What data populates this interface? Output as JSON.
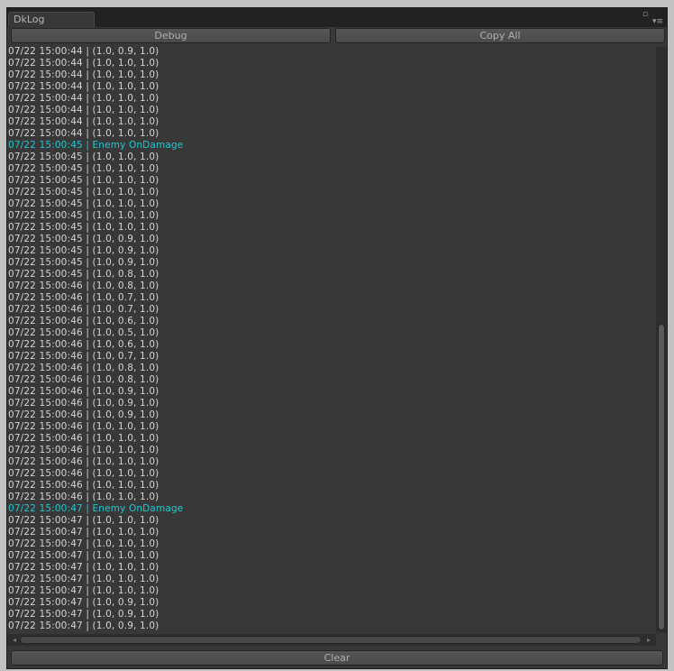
{
  "window": {
    "tab_title": "DkLog",
    "maximize_glyph": "▫",
    "menu_glyph": "▾≡"
  },
  "toolbar": {
    "debug_label": "Debug",
    "copy_all_label": "Copy All"
  },
  "scroll": {
    "left_arrow": "◂",
    "right_arrow": "▸",
    "vertical_position": 0.45
  },
  "log_lines": [
    {
      "text": "07/22 15:00:44 | (1.0, 0.9, 1.0)",
      "highlight": false
    },
    {
      "text": "07/22 15:00:44 | (1.0, 1.0, 1.0)",
      "highlight": false
    },
    {
      "text": "07/22 15:00:44 | (1.0, 1.0, 1.0)",
      "highlight": false
    },
    {
      "text": "07/22 15:00:44 | (1.0, 1.0, 1.0)",
      "highlight": false
    },
    {
      "text": "07/22 15:00:44 | (1.0, 1.0, 1.0)",
      "highlight": false
    },
    {
      "text": "07/22 15:00:44 | (1.0, 1.0, 1.0)",
      "highlight": false
    },
    {
      "text": "07/22 15:00:44 | (1.0, 1.0, 1.0)",
      "highlight": false
    },
    {
      "text": "07/22 15:00:44 | (1.0, 1.0, 1.0)",
      "highlight": false
    },
    {
      "text": "07/22 15:00:45 | Enemy OnDamage",
      "highlight": true
    },
    {
      "text": "07/22 15:00:45 | (1.0, 1.0, 1.0)",
      "highlight": false
    },
    {
      "text": "07/22 15:00:45 | (1.0, 1.0, 1.0)",
      "highlight": false
    },
    {
      "text": "07/22 15:00:45 | (1.0, 1.0, 1.0)",
      "highlight": false
    },
    {
      "text": "07/22 15:00:45 | (1.0, 1.0, 1.0)",
      "highlight": false
    },
    {
      "text": "07/22 15:00:45 | (1.0, 1.0, 1.0)",
      "highlight": false
    },
    {
      "text": "07/22 15:00:45 | (1.0, 1.0, 1.0)",
      "highlight": false
    },
    {
      "text": "07/22 15:00:45 | (1.0, 1.0, 1.0)",
      "highlight": false
    },
    {
      "text": "07/22 15:00:45 | (1.0, 0.9, 1.0)",
      "highlight": false
    },
    {
      "text": "07/22 15:00:45 | (1.0, 0.9, 1.0)",
      "highlight": false
    },
    {
      "text": "07/22 15:00:45 | (1.0, 0.9, 1.0)",
      "highlight": false
    },
    {
      "text": "07/22 15:00:45 | (1.0, 0.8, 1.0)",
      "highlight": false
    },
    {
      "text": "07/22 15:00:46 | (1.0, 0.8, 1.0)",
      "highlight": false
    },
    {
      "text": "07/22 15:00:46 | (1.0, 0.7, 1.0)",
      "highlight": false
    },
    {
      "text": "07/22 15:00:46 | (1.0, 0.7, 1.0)",
      "highlight": false
    },
    {
      "text": "07/22 15:00:46 | (1.0, 0.6, 1.0)",
      "highlight": false
    },
    {
      "text": "07/22 15:00:46 | (1.0, 0.5, 1.0)",
      "highlight": false
    },
    {
      "text": "07/22 15:00:46 | (1.0, 0.6, 1.0)",
      "highlight": false
    },
    {
      "text": "07/22 15:00:46 | (1.0, 0.7, 1.0)",
      "highlight": false
    },
    {
      "text": "07/22 15:00:46 | (1.0, 0.8, 1.0)",
      "highlight": false
    },
    {
      "text": "07/22 15:00:46 | (1.0, 0.8, 1.0)",
      "highlight": false
    },
    {
      "text": "07/22 15:00:46 | (1.0, 0.9, 1.0)",
      "highlight": false
    },
    {
      "text": "07/22 15:00:46 | (1.0, 0.9, 1.0)",
      "highlight": false
    },
    {
      "text": "07/22 15:00:46 | (1.0, 0.9, 1.0)",
      "highlight": false
    },
    {
      "text": "07/22 15:00:46 | (1.0, 1.0, 1.0)",
      "highlight": false
    },
    {
      "text": "07/22 15:00:46 | (1.0, 1.0, 1.0)",
      "highlight": false
    },
    {
      "text": "07/22 15:00:46 | (1.0, 1.0, 1.0)",
      "highlight": false
    },
    {
      "text": "07/22 15:00:46 | (1.0, 1.0, 1.0)",
      "highlight": false
    },
    {
      "text": "07/22 15:00:46 | (1.0, 1.0, 1.0)",
      "highlight": false
    },
    {
      "text": "07/22 15:00:46 | (1.0, 1.0, 1.0)",
      "highlight": false
    },
    {
      "text": "07/22 15:00:46 | (1.0, 1.0, 1.0)",
      "highlight": false
    },
    {
      "text": "07/22 15:00:47 | Enemy OnDamage",
      "highlight": true
    },
    {
      "text": "07/22 15:00:47 | (1.0, 1.0, 1.0)",
      "highlight": false
    },
    {
      "text": "07/22 15:00:47 | (1.0, 1.0, 1.0)",
      "highlight": false
    },
    {
      "text": "07/22 15:00:47 | (1.0, 1.0, 1.0)",
      "highlight": false
    },
    {
      "text": "07/22 15:00:47 | (1.0, 1.0, 1.0)",
      "highlight": false
    },
    {
      "text": "07/22 15:00:47 | (1.0, 1.0, 1.0)",
      "highlight": false
    },
    {
      "text": "07/22 15:00:47 | (1.0, 1.0, 1.0)",
      "highlight": false
    },
    {
      "text": "07/22 15:00:47 | (1.0, 1.0, 1.0)",
      "highlight": false
    },
    {
      "text": "07/22 15:00:47 | (1.0, 0.9, 1.0)",
      "highlight": false
    },
    {
      "text": "07/22 15:00:47 | (1.0, 0.9, 1.0)",
      "highlight": false
    },
    {
      "text": "07/22 15:00:47 | (1.0, 0.9, 1.0)",
      "highlight": false
    }
  ],
  "footer": {
    "clear_label": "Clear"
  },
  "colors": {
    "background": "#383838",
    "text": "#d4d4d4",
    "highlight": "#1fc8d2"
  }
}
